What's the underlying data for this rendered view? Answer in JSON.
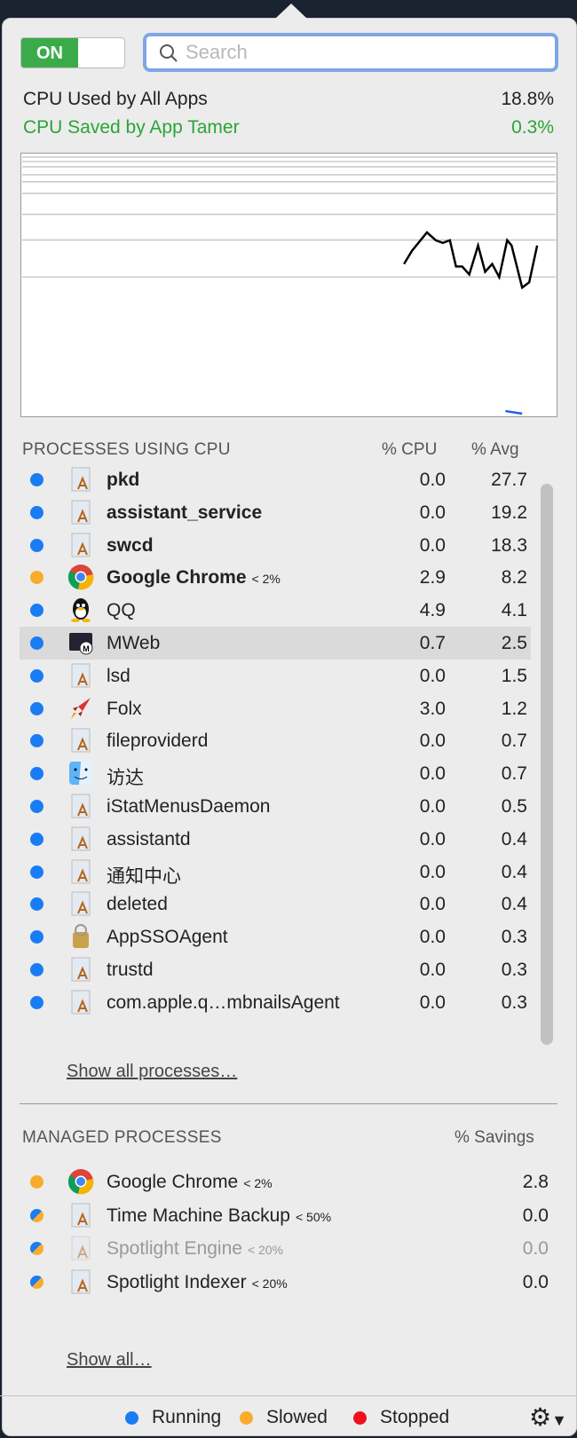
{
  "toggle": {
    "label": "ON",
    "state": "on"
  },
  "search": {
    "placeholder": "Search",
    "value": ""
  },
  "stats": {
    "used_label": "CPU Used by All Apps",
    "used_value": "18.8%",
    "saved_label": "CPU Saved by App Tamer",
    "saved_value": "0.3%",
    "saved_color": "#2aa534"
  },
  "chart_data": {
    "type": "line",
    "grid": true,
    "series": [
      {
        "color": "#000000",
        "values": [
          58,
          63,
          70,
          67,
          66,
          67,
          57,
          57,
          54,
          65,
          55,
          58,
          53,
          67,
          65,
          49,
          51,
          65
        ]
      },
      {
        "color": "#1f5fe6",
        "values": [
          2,
          1
        ]
      }
    ]
  },
  "processes": {
    "title": "PROCESSES USING CPU",
    "col_cpu": "% CPU",
    "col_avg": "% Avg",
    "show_all": "Show all processes…",
    "rows": [
      {
        "name": "pkd",
        "bold": true,
        "status": "running",
        "icon": "generic-app-icon",
        "cpu": "0.0",
        "avg": "27.7"
      },
      {
        "name": "assistant_service",
        "bold": true,
        "status": "running",
        "icon": "generic-app-icon",
        "cpu": "0.0",
        "avg": "19.2"
      },
      {
        "name": "swcd",
        "bold": true,
        "status": "running",
        "icon": "generic-app-icon",
        "cpu": "0.0",
        "avg": "18.3"
      },
      {
        "name": "Google Chrome",
        "limit": "< 2%",
        "bold": true,
        "status": "slowed",
        "icon": "chrome-icon",
        "cpu": "2.9",
        "avg": "8.2"
      },
      {
        "name": "QQ",
        "status": "running",
        "icon": "qq-penguin-icon",
        "cpu": "4.9",
        "avg": "4.1"
      },
      {
        "name": "MWeb",
        "status": "running",
        "icon": "mweb-icon",
        "cpu": "0.7",
        "avg": "2.5",
        "selected": true
      },
      {
        "name": "lsd",
        "status": "running",
        "icon": "generic-app-icon",
        "cpu": "0.0",
        "avg": "1.5"
      },
      {
        "name": "Folx",
        "status": "running",
        "icon": "folx-rocket-icon",
        "cpu": "3.0",
        "avg": "1.2"
      },
      {
        "name": "fileproviderd",
        "status": "running",
        "icon": "generic-app-icon",
        "cpu": "0.0",
        "avg": "0.7"
      },
      {
        "name": "访达",
        "status": "running",
        "icon": "finder-icon",
        "cpu": "0.0",
        "avg": "0.7"
      },
      {
        "name": "iStatMenusDaemon",
        "status": "running",
        "icon": "generic-app-icon",
        "cpu": "0.0",
        "avg": "0.5"
      },
      {
        "name": "assistantd",
        "status": "running",
        "icon": "generic-app-icon",
        "cpu": "0.0",
        "avg": "0.4"
      },
      {
        "name": "通知中心",
        "status": "running",
        "icon": "generic-app-icon",
        "cpu": "0.0",
        "avg": "0.4"
      },
      {
        "name": "deleted",
        "status": "running",
        "icon": "generic-app-icon",
        "cpu": "0.0",
        "avg": "0.4"
      },
      {
        "name": "AppSSOAgent",
        "status": "running",
        "icon": "appsso-icon",
        "cpu": "0.0",
        "avg": "0.3"
      },
      {
        "name": "trustd",
        "status": "running",
        "icon": "generic-app-icon",
        "cpu": "0.0",
        "avg": "0.3"
      },
      {
        "name": "com.apple.q…mbnailsAgent",
        "status": "running",
        "icon": "generic-app-icon",
        "cpu": "0.0",
        "avg": "0.3"
      }
    ]
  },
  "managed": {
    "title": "MANAGED PROCESSES",
    "col_savings": "% Savings",
    "show_all": "Show all…",
    "rows": [
      {
        "name": "Google Chrome",
        "limit": "< 2%",
        "status": "slowed",
        "icon": "chrome-icon",
        "savings": "2.8"
      },
      {
        "name": "Time Machine Backup",
        "limit": "< 50%",
        "status": "mixed",
        "icon": "generic-app-icon",
        "savings": "0.0"
      },
      {
        "name": "Spotlight Engine",
        "limit": "< 20%",
        "status": "mixed",
        "icon": "generic-app-icon",
        "savings": "0.0",
        "dimmed": true
      },
      {
        "name": "Spotlight Indexer",
        "limit": "< 20%",
        "status": "mixed",
        "icon": "generic-app-icon",
        "savings": "0.0"
      }
    ]
  },
  "legend": {
    "running": "Running",
    "slowed": "Slowed",
    "stopped": "Stopped",
    "colors": {
      "running": "#1a7cf5",
      "slowed": "#f9ac2c",
      "stopped": "#f0101c"
    }
  }
}
